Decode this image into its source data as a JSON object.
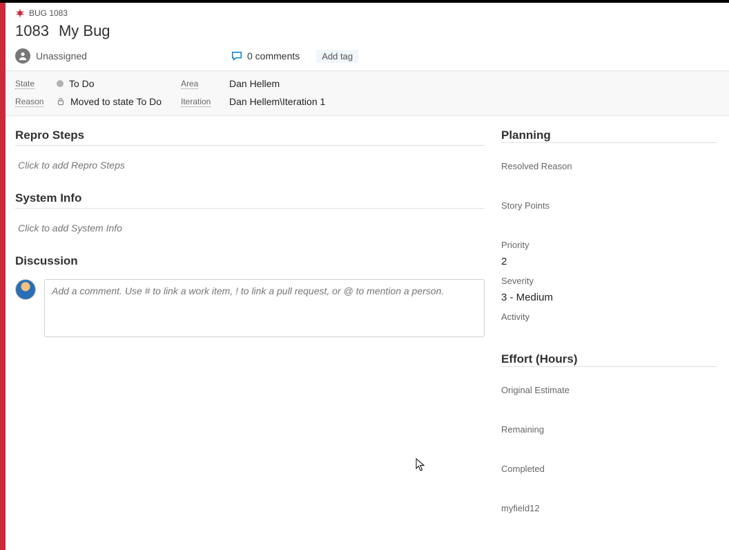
{
  "header": {
    "type_label": "BUG 1083",
    "id": "1083",
    "title": "My Bug",
    "assignee": "Unassigned",
    "comments_label": "0 comments",
    "add_tag_label": "Add tag"
  },
  "state_grid": {
    "state_label": "State",
    "state_value": "To Do",
    "reason_label": "Reason",
    "reason_value": "Moved to state To Do",
    "area_label": "Area",
    "area_value": "Dan Hellem",
    "iteration_label": "Iteration",
    "iteration_value": "Dan Hellem\\Iteration 1"
  },
  "sections": {
    "repro_title": "Repro Steps",
    "repro_placeholder": "Click to add Repro Steps",
    "sysinfo_title": "System Info",
    "sysinfo_placeholder": "Click to add System Info",
    "discussion_title": "Discussion",
    "comment_placeholder": "Add a comment. Use # to link a work item, ! to link a pull request, or @ to mention a person."
  },
  "planning": {
    "title": "Planning",
    "resolved_reason_label": "Resolved Reason",
    "story_points_label": "Story Points",
    "priority_label": "Priority",
    "priority_value": "2",
    "severity_label": "Severity",
    "severity_value": "3 - Medium",
    "activity_label": "Activity"
  },
  "effort": {
    "title": "Effort (Hours)",
    "original_estimate_label": "Original Estimate",
    "remaining_label": "Remaining",
    "completed_label": "Completed",
    "custom_field_label": "myfield12"
  },
  "colors": {
    "rail": "#cc293d",
    "accent": "#0078d4"
  }
}
